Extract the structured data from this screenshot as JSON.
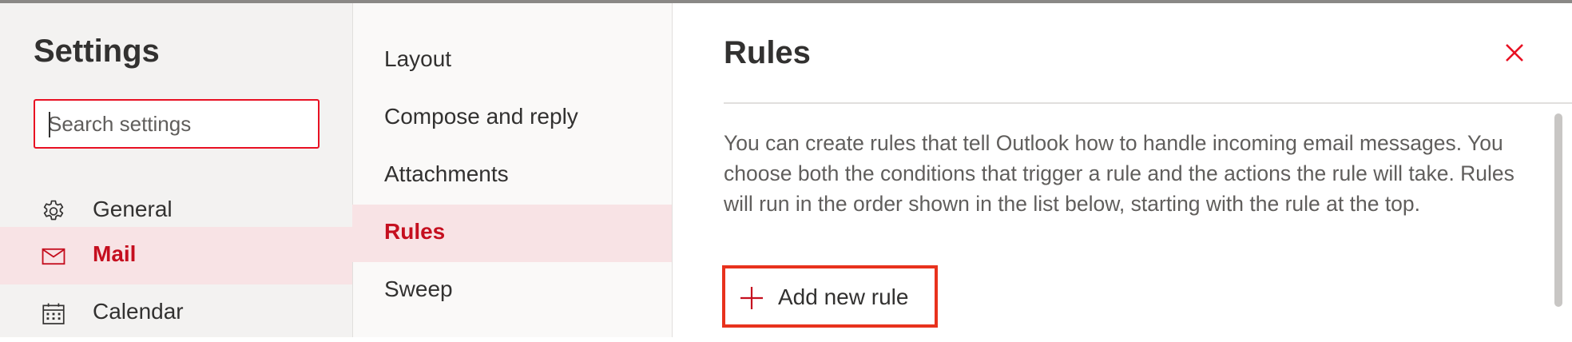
{
  "settings": {
    "title": "Settings"
  },
  "search": {
    "placeholder": "Search settings",
    "value": ""
  },
  "nav": {
    "items": [
      {
        "label": "General",
        "icon": "gear-icon",
        "active": false
      },
      {
        "label": "Mail",
        "icon": "mail-icon",
        "active": true
      },
      {
        "label": "Calendar",
        "icon": "calendar-icon",
        "active": false
      }
    ]
  },
  "mail_nav": {
    "items": [
      {
        "label": "Layout",
        "active": false
      },
      {
        "label": "Compose and reply",
        "active": false
      },
      {
        "label": "Attachments",
        "active": false
      },
      {
        "label": "Rules",
        "active": true
      },
      {
        "label": "Sweep",
        "active": false
      }
    ]
  },
  "rules": {
    "title": "Rules",
    "description": "You can create rules that tell Outlook how to handle incoming email messages. You choose both the conditions that trigger a rule and the actions the rule will take. Rules will run in the order shown in the list below, starting with the rule at the top.",
    "add_button_label": "Add new rule"
  },
  "colors": {
    "accent": "#c50f1f",
    "active_bg": "#f8e3e5",
    "highlight_border": "#e8321d",
    "close_icon": "#e81123"
  }
}
